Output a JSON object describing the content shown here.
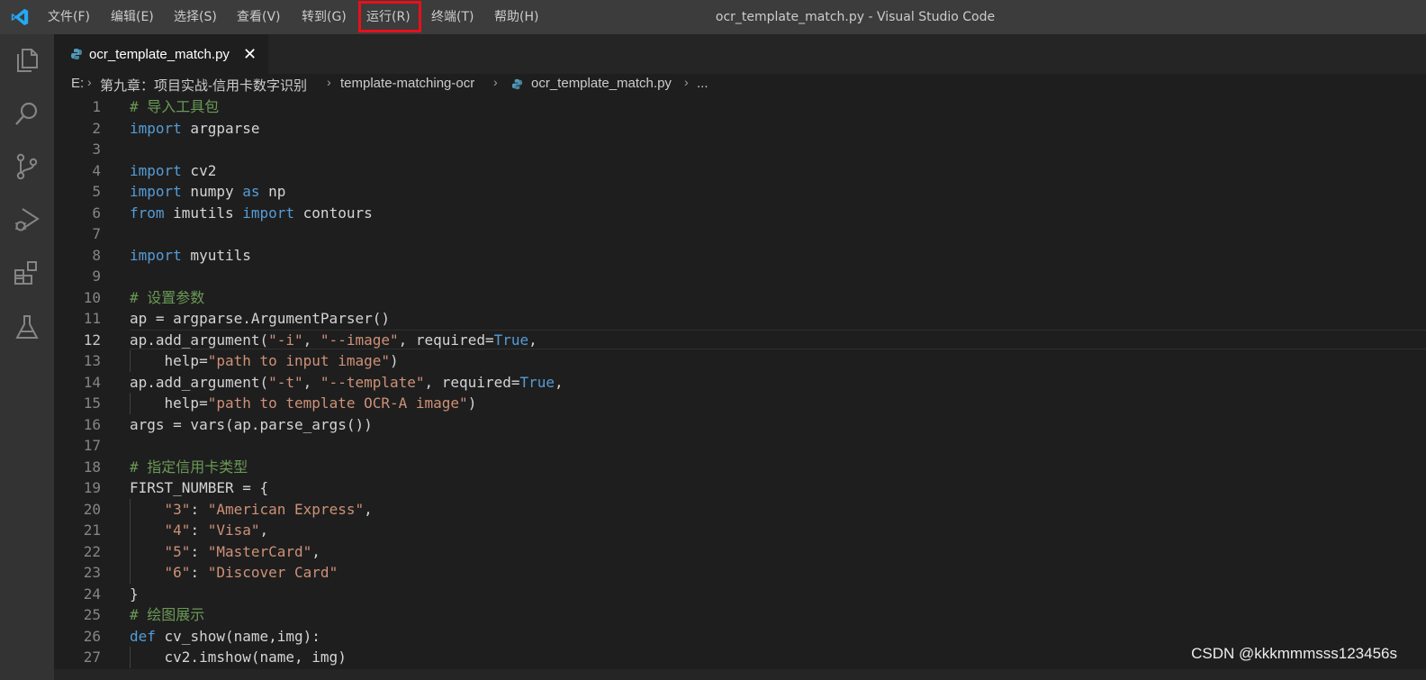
{
  "titlebar": {
    "menu": [
      "文件(F)",
      "编辑(E)",
      "选择(S)",
      "查看(V)",
      "转到(G)",
      "运行(R)",
      "终端(T)",
      "帮助(H)"
    ],
    "window_title": "ocr_template_match.py - Visual Studio Code",
    "highlighted_menu": "运行(R)"
  },
  "activity_bar": {
    "icons": [
      "explorer-icon",
      "search-icon",
      "source-control-icon",
      "run-debug-icon",
      "extensions-icon",
      "testing-icon"
    ]
  },
  "tab": {
    "label": "ocr_template_match.py",
    "close": "✕"
  },
  "breadcrumb": {
    "parts": [
      "E:",
      "第九章：项目实战-信用卡数字识别",
      "template-matching-ocr",
      "ocr_template_match.py",
      "..."
    ]
  },
  "editor": {
    "current_line": 12,
    "lines": [
      {
        "n": "1",
        "t": "# 导入工具包"
      },
      {
        "n": "2",
        "t": "import argparse"
      },
      {
        "n": "3",
        "t": ""
      },
      {
        "n": "4",
        "t": "import cv2"
      },
      {
        "n": "5",
        "t": "import numpy as np"
      },
      {
        "n": "6",
        "t": "from imutils import contours"
      },
      {
        "n": "7",
        "t": ""
      },
      {
        "n": "8",
        "t": "import myutils"
      },
      {
        "n": "9",
        "t": ""
      },
      {
        "n": "10",
        "t": "# 设置参数"
      },
      {
        "n": "11",
        "t": "ap = argparse.ArgumentParser()"
      },
      {
        "n": "12",
        "t": "ap.add_argument(\"-i\", \"--image\", required=True,"
      },
      {
        "n": "13",
        "t": "    help=\"path to input image\")"
      },
      {
        "n": "14",
        "t": "ap.add_argument(\"-t\", \"--template\", required=True,"
      },
      {
        "n": "15",
        "t": "    help=\"path to template OCR-A image\")"
      },
      {
        "n": "16",
        "t": "args = vars(ap.parse_args())"
      },
      {
        "n": "17",
        "t": ""
      },
      {
        "n": "18",
        "t": "# 指定信用卡类型"
      },
      {
        "n": "19",
        "t": "FIRST_NUMBER = {"
      },
      {
        "n": "20",
        "t": "    \"3\": \"American Express\","
      },
      {
        "n": "21",
        "t": "    \"4\": \"Visa\","
      },
      {
        "n": "22",
        "t": "    \"5\": \"MasterCard\","
      },
      {
        "n": "23",
        "t": "    \"6\": \"Discover Card\""
      },
      {
        "n": "24",
        "t": "}"
      },
      {
        "n": "25",
        "t": "# 绘图展示"
      },
      {
        "n": "26",
        "t": "def cv_show(name,img):"
      },
      {
        "n": "27",
        "t": "    cv2.imshow(name, img)"
      }
    ]
  },
  "watermark": "CSDN @kkkmmmsss123456s",
  "colors": {
    "keyword": "#569cd6",
    "string": "#ce9178",
    "comment": "#6a9955",
    "highlight_box": "#e8101a"
  }
}
